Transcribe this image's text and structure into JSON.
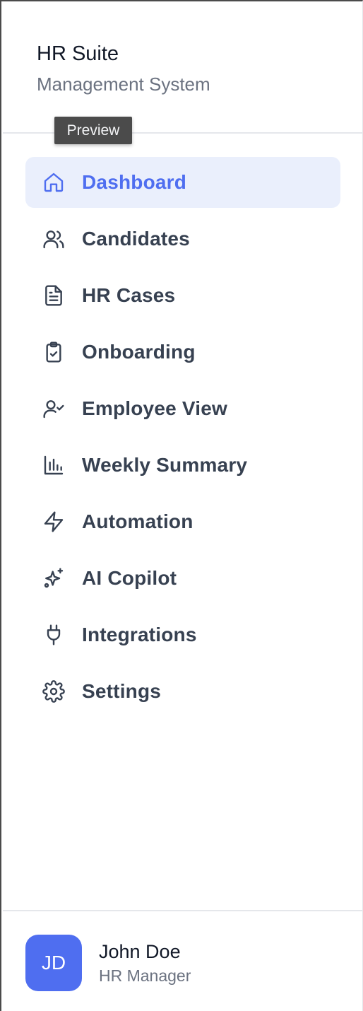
{
  "brand": {
    "title": "HR Suite",
    "subtitle": "Management System"
  },
  "tooltip": {
    "text": "Preview"
  },
  "nav": {
    "items": [
      {
        "label": "Dashboard",
        "icon": "home-icon",
        "active": true
      },
      {
        "label": "Candidates",
        "icon": "users-icon"
      },
      {
        "label": "HR Cases",
        "icon": "document-icon"
      },
      {
        "label": "Onboarding",
        "icon": "clipboard-check-icon"
      },
      {
        "label": "Employee View",
        "icon": "user-check-icon"
      },
      {
        "label": "Weekly Summary",
        "icon": "bar-chart-icon"
      },
      {
        "label": "Automation",
        "icon": "lightning-icon"
      },
      {
        "label": "AI Copilot",
        "icon": "sparkles-icon"
      },
      {
        "label": "Integrations",
        "icon": "plug-icon"
      },
      {
        "label": "Settings",
        "icon": "gear-icon"
      }
    ]
  },
  "user": {
    "initials": "JD",
    "name": "John Doe",
    "role": "HR Manager"
  },
  "colors": {
    "accent": "#4f6ef0",
    "active_bg": "#eaeffc",
    "text": "#374151",
    "muted": "#6b7280"
  }
}
